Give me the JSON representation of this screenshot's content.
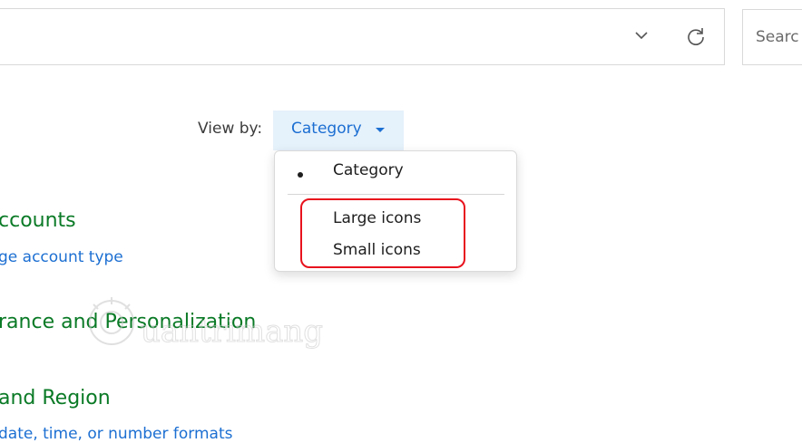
{
  "address_bar": {
    "dropdown_icon": "chevron-down-icon",
    "refresh_icon": "refresh-icon"
  },
  "search": {
    "placeholder": "Searc"
  },
  "view_by": {
    "label": "View by:",
    "selected": "Category",
    "caret_icon": "caret-down-icon"
  },
  "view_menu": {
    "items": [
      {
        "label": "Category",
        "selected": true
      },
      {
        "label": "Large icons",
        "selected": false
      },
      {
        "label": "Small icons",
        "selected": false
      }
    ],
    "highlight_color": "#e8121d"
  },
  "categories": [
    {
      "title": "ccounts",
      "link": "ge account type"
    },
    {
      "title": "rance and Personalization",
      "link": ""
    },
    {
      "title": "and Region",
      "link": "date, time, or number formats"
    }
  ],
  "watermark": {
    "text": "uantrimang"
  },
  "colors": {
    "category_green": "#0a7a26",
    "link_blue": "#1c6fd2",
    "view_button_bg": "#e5f1fb"
  }
}
